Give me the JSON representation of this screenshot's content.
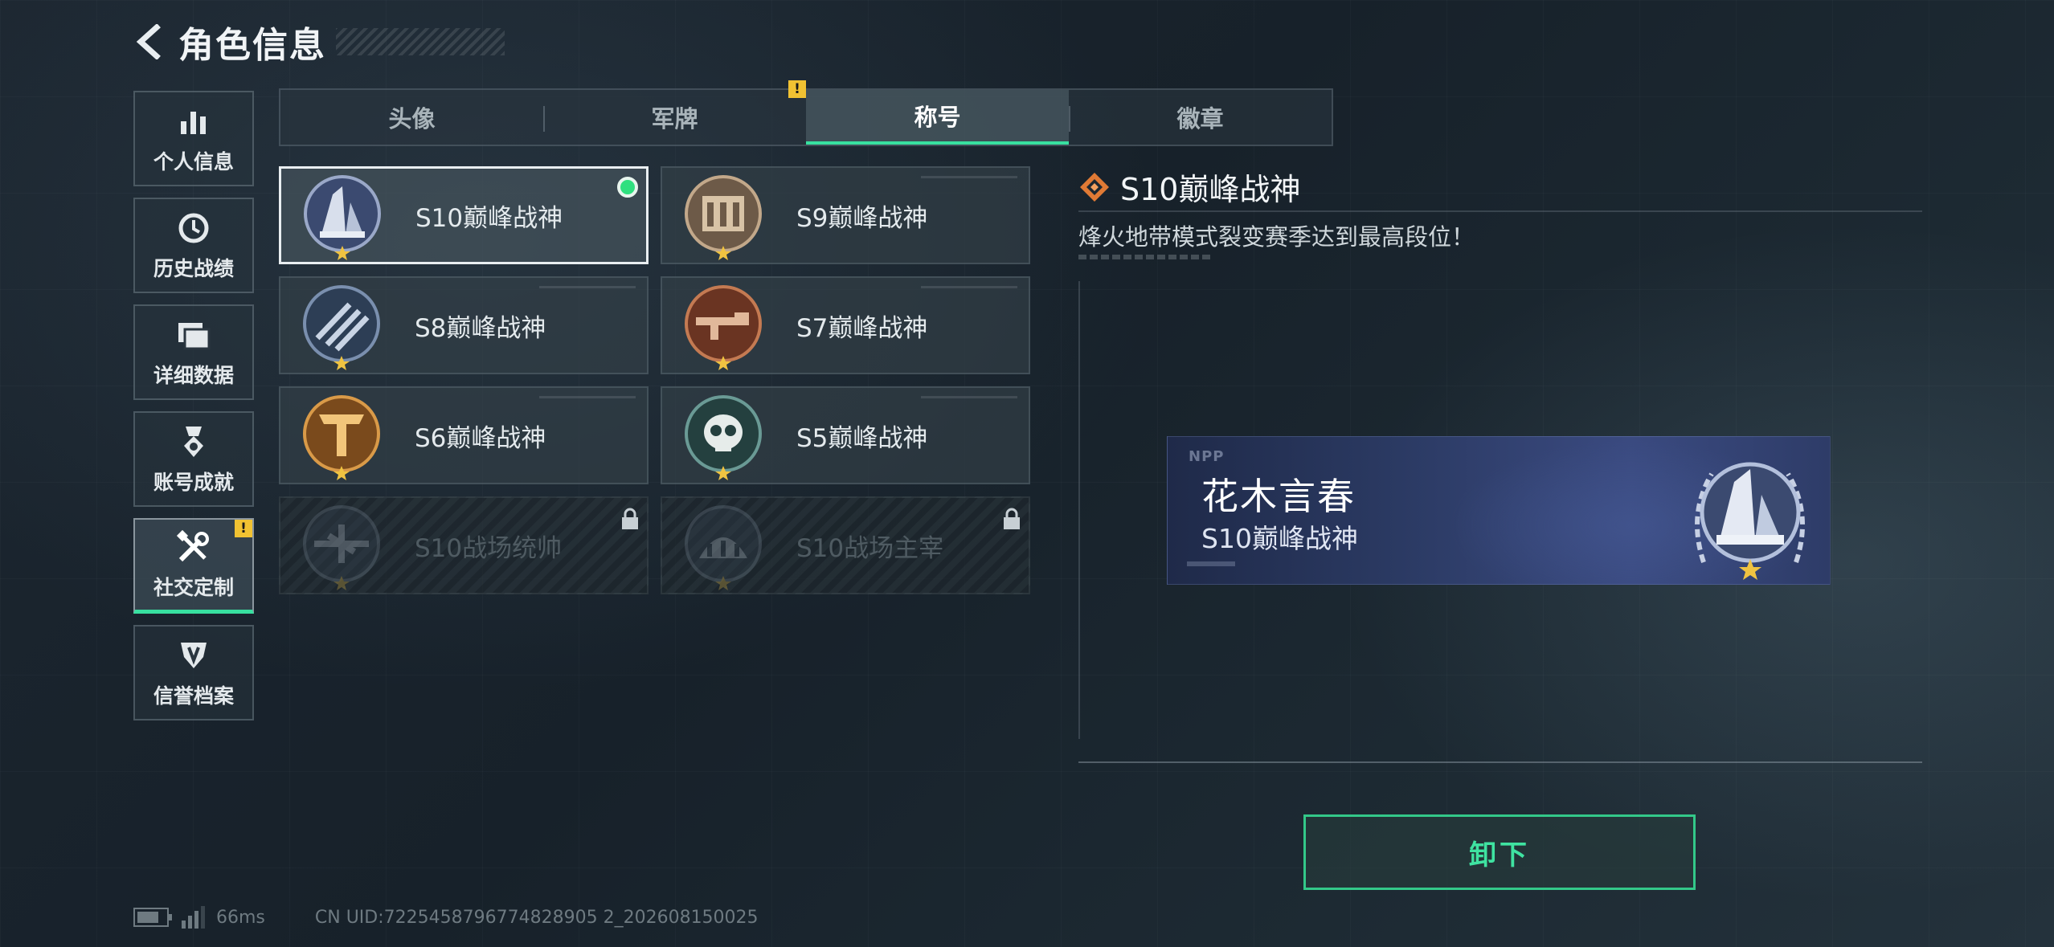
{
  "header": {
    "title": "角色信息"
  },
  "sidebar": {
    "items": [
      {
        "label": "个人信息",
        "icon": "bar-chart-icon"
      },
      {
        "label": "历史战绩",
        "icon": "history-clock-icon"
      },
      {
        "label": "详细数据",
        "icon": "folder-icon"
      },
      {
        "label": "账号成就",
        "icon": "medal-icon"
      },
      {
        "label": "社交定制",
        "icon": "tools-icon",
        "active": true,
        "badge": "!"
      },
      {
        "label": "信誉档案",
        "icon": "shield-icon"
      }
    ]
  },
  "tabs": [
    {
      "label": "头像"
    },
    {
      "label": "军牌",
      "badge": "!"
    },
    {
      "label": "称号",
      "active": true
    },
    {
      "label": "徽章"
    }
  ],
  "titles": [
    {
      "label": "S10巅峰战神",
      "selected": true,
      "equipped": true,
      "emblem": "s10-tower-emblem",
      "color": "#8a9bbf"
    },
    {
      "label": "S9巅峰战神",
      "emblem": "s9-building-emblem",
      "color": "#b89a7a"
    },
    {
      "label": "S8巅峰战神",
      "emblem": "s8-stripes-emblem",
      "color": "#5c7394"
    },
    {
      "label": "S7巅峰战神",
      "emblem": "s7-rifle-emblem",
      "color": "#b56a45"
    },
    {
      "label": "S6巅峰战神",
      "emblem": "s6-t-emblem",
      "color": "#c98a3a"
    },
    {
      "label": "S5巅峰战神",
      "emblem": "s5-skull-emblem",
      "color": "#4a7e7a"
    },
    {
      "label": "S10战场统帅",
      "locked": true,
      "emblem": "s10-plane-emblem",
      "color": "#55606a"
    },
    {
      "label": "S10战场主宰",
      "locked": true,
      "emblem": "s10-colosseum-emblem",
      "color": "#55606a"
    }
  ],
  "detail": {
    "name": "S10巅峰战神",
    "description": "烽火地带模式裂变赛季达到最高段位！"
  },
  "preview": {
    "logo": "NPP",
    "player_name": "花木言春",
    "title": "S10巅峰战神"
  },
  "actions": {
    "unequip_label": "卸下"
  },
  "status": {
    "battery_level": 0.8,
    "ping": "66ms",
    "uid": "CN UID:7225458796774828905 2_202608150025"
  },
  "colors": {
    "accent": "#38e0a0",
    "warning": "#f1c232"
  }
}
